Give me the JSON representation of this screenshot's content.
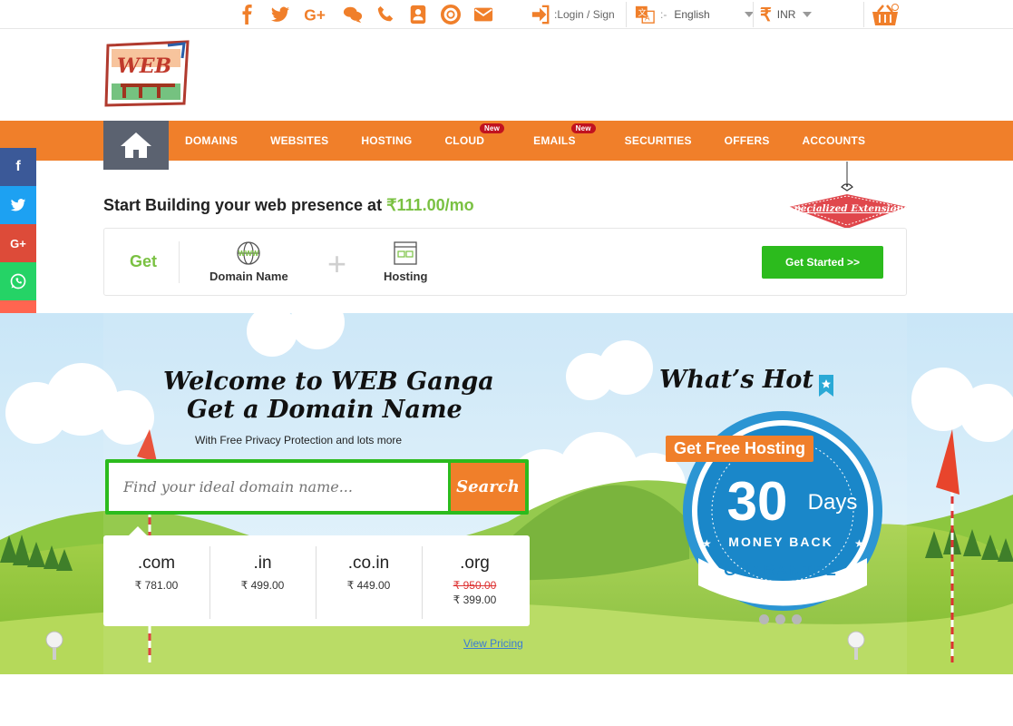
{
  "topbar": {
    "icons": [
      "facebook-icon",
      "twitter-icon",
      "google-plus-icon",
      "chat-icon",
      "phone-icon",
      "contacts-icon",
      "support-icon",
      "mail-icon"
    ],
    "login_label": ":Login / Sign",
    "language": "English",
    "currency_symbol": "₹",
    "currency": "INR"
  },
  "logo": {
    "text": "WEB"
  },
  "nav": {
    "items": [
      {
        "label": "DOMAINS",
        "new": ""
      },
      {
        "label": "WEBSITES",
        "new": ""
      },
      {
        "label": "HOSTING",
        "new": ""
      },
      {
        "label": "CLOUD",
        "new": "New"
      },
      {
        "label": "EMAILS",
        "new": "New"
      },
      {
        "label": "SECURITIES",
        "new": ""
      },
      {
        "label": "OFFERS",
        "new": ""
      },
      {
        "label": "ACCOUNTS",
        "new": ""
      }
    ]
  },
  "social": [
    "f",
    "t",
    "G+",
    "w",
    "+"
  ],
  "promo": {
    "text": "Start Building your web presence at ",
    "price": "₹111.00/mo"
  },
  "ribbon": {
    "label": "Specialized Extensions"
  },
  "getbox": {
    "label": "Get",
    "item1": "Domain Name",
    "item1_icon_text": "WWW",
    "plus": "+",
    "item2": "Hosting",
    "button": "Get Started >>"
  },
  "hero": {
    "welcome_line1": "Welcome to WEB Ganga",
    "welcome_line2": "Get a Domain Name",
    "subtitle": "With Free Privacy Protection and lots more",
    "search_placeholder": "Find your ideal domain name...",
    "search_button": "Search",
    "tlds": [
      {
        "name": ".com",
        "price": "₹ 781.00",
        "old": ""
      },
      {
        "name": ".in",
        "price": "₹ 499.00",
        "old": ""
      },
      {
        "name": ".co.in",
        "price": "₹ 449.00",
        "old": ""
      },
      {
        "name": ".org",
        "price": "₹ 399.00",
        "old": "₹ 950.00"
      }
    ],
    "view_pricing": "View Pricing",
    "whats_hot": "What’s Hot",
    "free_hosting": "Get Free Hosting",
    "badge_number": "30",
    "badge_days": "Days",
    "badge_money": "MONEY BACK",
    "badge_guarantee": "GUARANTEE"
  },
  "colors": {
    "orange": "#f07f2a",
    "green": "#2cbb1d",
    "promo_green": "#7ac142",
    "badge_blue": "#1a87c9"
  }
}
